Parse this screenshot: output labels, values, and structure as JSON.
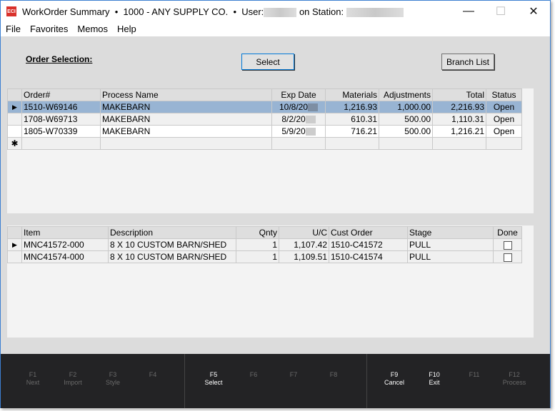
{
  "window": {
    "logo": "ECI",
    "title": "WorkOrder Summary  •  1000 - ANY SUPPLY CO.  •  User:",
    "station_label": "on Station:",
    "minimize": "—",
    "maximize": "☐",
    "close": "✕"
  },
  "menu": [
    "File",
    "Favorites",
    "Memos",
    "Help"
  ],
  "order_selection": {
    "label": "Order Selection:",
    "select_button": "Select",
    "branch_button": "Branch List"
  },
  "orders": {
    "columns": [
      "Order#",
      "Process Name",
      "Exp Date",
      "Materials",
      "Adjustments",
      "Total",
      "Status"
    ],
    "rows": [
      [
        "1510-W69146",
        "MAKEBARN",
        "10/8/20",
        "1,216.93",
        "1,000.00",
        "2,216.93",
        "Open"
      ],
      [
        "1708-W69713",
        "MAKEBARN",
        "8/2/20",
        "610.31",
        "500.00",
        "1,110.31",
        "Open"
      ],
      [
        "1805-W70339",
        "MAKEBARN",
        "5/9/20",
        "716.21",
        "500.00",
        "1,216.21",
        "Open"
      ]
    ],
    "new_row_marker": "✱",
    "current_row_marker": "▶"
  },
  "items": {
    "columns": [
      "Item",
      "Description",
      "Qnty",
      "U/C",
      "Cust Order",
      "Stage",
      "Done"
    ],
    "rows": [
      [
        "MNC41572-000",
        "8 X 10 CUSTOM BARN/SHED",
        "1",
        "1,107.42",
        "1510-C41572",
        "PULL",
        false
      ],
      [
        "MNC41574-000",
        "8 X 10 CUSTOM BARN/SHED",
        "1",
        "1,109.51",
        "1510-C41574",
        "PULL",
        false
      ]
    ]
  },
  "function_keys": [
    {
      "key": "F1",
      "label": "Next",
      "enabled": false
    },
    {
      "key": "F2",
      "label": "Import",
      "enabled": false
    },
    {
      "key": "F3",
      "label": "Style",
      "enabled": false
    },
    {
      "key": "F4",
      "label": "",
      "enabled": false
    },
    {
      "key": "F5",
      "label": "Select",
      "enabled": true
    },
    {
      "key": "F6",
      "label": "",
      "enabled": false
    },
    {
      "key": "F7",
      "label": "",
      "enabled": false
    },
    {
      "key": "F8",
      "label": "",
      "enabled": false
    },
    {
      "key": "F9",
      "label": "Cancel",
      "enabled": true
    },
    {
      "key": "F10",
      "label": "Exit",
      "enabled": true
    },
    {
      "key": "F11",
      "label": "",
      "enabled": false
    },
    {
      "key": "F12",
      "label": "Process",
      "enabled": false
    }
  ]
}
